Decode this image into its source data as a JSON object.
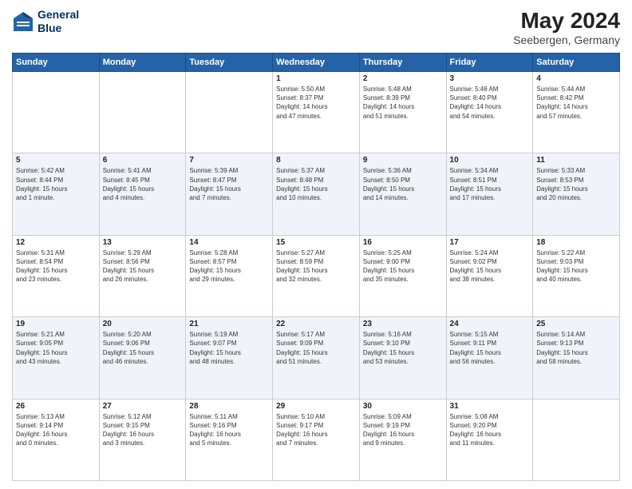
{
  "header": {
    "logo_line1": "General",
    "logo_line2": "Blue",
    "title": "May 2024",
    "location": "Seebergen, Germany"
  },
  "weekdays": [
    "Sunday",
    "Monday",
    "Tuesday",
    "Wednesday",
    "Thursday",
    "Friday",
    "Saturday"
  ],
  "weeks": [
    [
      {
        "date": "",
        "info": ""
      },
      {
        "date": "",
        "info": ""
      },
      {
        "date": "",
        "info": ""
      },
      {
        "date": "1",
        "info": "Sunrise: 5:50 AM\nSunset: 8:37 PM\nDaylight: 14 hours\nand 47 minutes."
      },
      {
        "date": "2",
        "info": "Sunrise: 5:48 AM\nSunset: 8:39 PM\nDaylight: 14 hours\nand 51 minutes."
      },
      {
        "date": "3",
        "info": "Sunrise: 5:46 AM\nSunset: 8:40 PM\nDaylight: 14 hours\nand 54 minutes."
      },
      {
        "date": "4",
        "info": "Sunrise: 5:44 AM\nSunset: 8:42 PM\nDaylight: 14 hours\nand 57 minutes."
      }
    ],
    [
      {
        "date": "5",
        "info": "Sunrise: 5:42 AM\nSunset: 8:44 PM\nDaylight: 15 hours\nand 1 minute."
      },
      {
        "date": "6",
        "info": "Sunrise: 5:41 AM\nSunset: 8:45 PM\nDaylight: 15 hours\nand 4 minutes."
      },
      {
        "date": "7",
        "info": "Sunrise: 5:39 AM\nSunset: 8:47 PM\nDaylight: 15 hours\nand 7 minutes."
      },
      {
        "date": "8",
        "info": "Sunrise: 5:37 AM\nSunset: 8:48 PM\nDaylight: 15 hours\nand 10 minutes."
      },
      {
        "date": "9",
        "info": "Sunrise: 5:36 AM\nSunset: 8:50 PM\nDaylight: 15 hours\nand 14 minutes."
      },
      {
        "date": "10",
        "info": "Sunrise: 5:34 AM\nSunset: 8:51 PM\nDaylight: 15 hours\nand 17 minutes."
      },
      {
        "date": "11",
        "info": "Sunrise: 5:33 AM\nSunset: 8:53 PM\nDaylight: 15 hours\nand 20 minutes."
      }
    ],
    [
      {
        "date": "12",
        "info": "Sunrise: 5:31 AM\nSunset: 8:54 PM\nDaylight: 15 hours\nand 23 minutes."
      },
      {
        "date": "13",
        "info": "Sunrise: 5:29 AM\nSunset: 8:56 PM\nDaylight: 15 hours\nand 26 minutes."
      },
      {
        "date": "14",
        "info": "Sunrise: 5:28 AM\nSunset: 8:57 PM\nDaylight: 15 hours\nand 29 minutes."
      },
      {
        "date": "15",
        "info": "Sunrise: 5:27 AM\nSunset: 8:59 PM\nDaylight: 15 hours\nand 32 minutes."
      },
      {
        "date": "16",
        "info": "Sunrise: 5:25 AM\nSunset: 9:00 PM\nDaylight: 15 hours\nand 35 minutes."
      },
      {
        "date": "17",
        "info": "Sunrise: 5:24 AM\nSunset: 9:02 PM\nDaylight: 15 hours\nand 38 minutes."
      },
      {
        "date": "18",
        "info": "Sunrise: 5:22 AM\nSunset: 9:03 PM\nDaylight: 15 hours\nand 40 minutes."
      }
    ],
    [
      {
        "date": "19",
        "info": "Sunrise: 5:21 AM\nSunset: 9:05 PM\nDaylight: 15 hours\nand 43 minutes."
      },
      {
        "date": "20",
        "info": "Sunrise: 5:20 AM\nSunset: 9:06 PM\nDaylight: 15 hours\nand 46 minutes."
      },
      {
        "date": "21",
        "info": "Sunrise: 5:19 AM\nSunset: 9:07 PM\nDaylight: 15 hours\nand 48 minutes."
      },
      {
        "date": "22",
        "info": "Sunrise: 5:17 AM\nSunset: 9:09 PM\nDaylight: 15 hours\nand 51 minutes."
      },
      {
        "date": "23",
        "info": "Sunrise: 5:16 AM\nSunset: 9:10 PM\nDaylight: 15 hours\nand 53 minutes."
      },
      {
        "date": "24",
        "info": "Sunrise: 5:15 AM\nSunset: 9:11 PM\nDaylight: 15 hours\nand 56 minutes."
      },
      {
        "date": "25",
        "info": "Sunrise: 5:14 AM\nSunset: 9:13 PM\nDaylight: 15 hours\nand 58 minutes."
      }
    ],
    [
      {
        "date": "26",
        "info": "Sunrise: 5:13 AM\nSunset: 9:14 PM\nDaylight: 16 hours\nand 0 minutes."
      },
      {
        "date": "27",
        "info": "Sunrise: 5:12 AM\nSunset: 9:15 PM\nDaylight: 16 hours\nand 3 minutes."
      },
      {
        "date": "28",
        "info": "Sunrise: 5:11 AM\nSunset: 9:16 PM\nDaylight: 16 hours\nand 5 minutes."
      },
      {
        "date": "29",
        "info": "Sunrise: 5:10 AM\nSunset: 9:17 PM\nDaylight: 16 hours\nand 7 minutes."
      },
      {
        "date": "30",
        "info": "Sunrise: 5:09 AM\nSunset: 9:19 PM\nDaylight: 16 hours\nand 9 minutes."
      },
      {
        "date": "31",
        "info": "Sunrise: 5:08 AM\nSunset: 9:20 PM\nDaylight: 16 hours\nand 11 minutes."
      },
      {
        "date": "",
        "info": ""
      }
    ]
  ]
}
